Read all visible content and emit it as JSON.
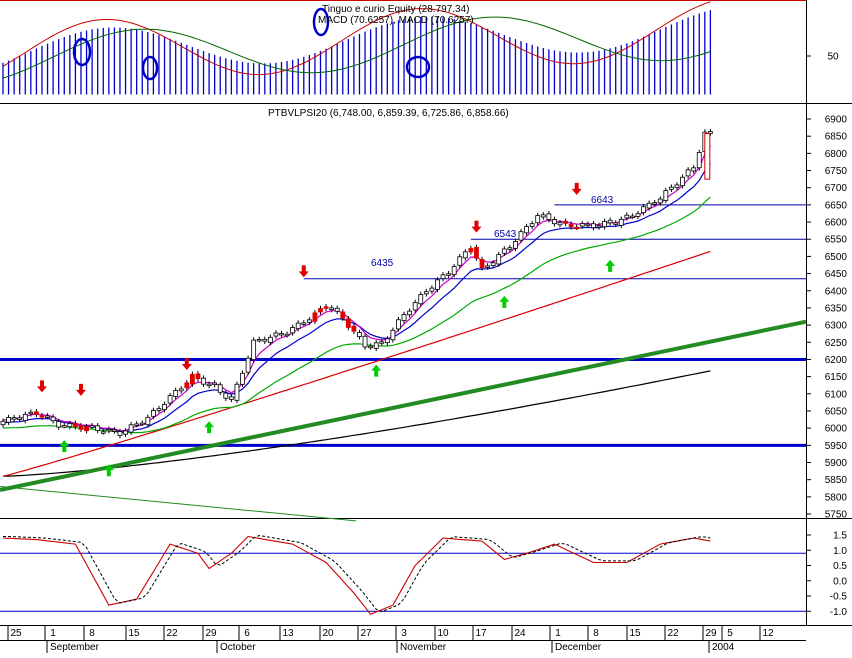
{
  "chart_data": {
    "type": "candlestick",
    "colors": {
      "background": "#ffffff",
      "grid": "#000000",
      "up_candle": "#ffffff",
      "down_candle": "#e00000",
      "ema_short": "#cc00cc",
      "ema_mid": "#0000cc",
      "ema_long": "#00aa00",
      "ema_200": "#dd0000",
      "long_ma": "#000000",
      "trendline": "#228b22",
      "support_lines": "#0000cc",
      "level_lines": "#0000aa",
      "macd_hist": "#0000cc",
      "macd_line": "#cc0000",
      "signal_line": "#006600",
      "stoch_k": "#cc0000",
      "stoch_d": "#000000",
      "sell_arrow": "#e00000",
      "buy_arrow": "#00cc00",
      "circle": "#0000cc"
    },
    "top_panel": {
      "labels": [
        "Tinguo e curio Equity (28.797.34)",
        "MACD (70.6257), MACD (70.6257)"
      ],
      "ticks": [
        "50"
      ],
      "ylim": [
        -20,
        170
      ]
    },
    "main_panel": {
      "title": "PTBVLPSI20 (6,748.00, 6,859.39, 6,725.86, 6,858.66)",
      "ylim": [
        5710,
        6930
      ],
      "ticks": [
        "6900",
        "6850",
        "6800",
        "6750",
        "6700",
        "6650",
        "6600",
        "6550",
        "6500",
        "6450",
        "6400",
        "6350",
        "6300",
        "6250",
        "6200",
        "6150",
        "6100",
        "6050",
        "6000",
        "5950",
        "5900",
        "5850",
        "5800",
        "5750"
      ],
      "level_labels": [
        {
          "text": "6435",
          "value": 6435
        },
        {
          "text": "6543",
          "value": 6550
        },
        {
          "text": "6643",
          "value": 6650
        }
      ],
      "support_lines": [
        6200,
        5950
      ]
    },
    "stoch_panel": {
      "ylim": [
        -1.2,
        1.7
      ],
      "ticks": [
        "1.5",
        "1.0",
        "0.5",
        "0.0",
        "-0.5",
        "-1.0"
      ],
      "reference_lines": [
        0.9,
        -1.0
      ]
    },
    "x_axis": {
      "days": [
        "25",
        "1",
        "8",
        "15",
        "22",
        "29",
        "6",
        "13",
        "20",
        "27",
        "3",
        "10",
        "17",
        "24",
        "1",
        "8",
        "15",
        "22",
        "29",
        "5",
        "12"
      ],
      "months": [
        "September",
        "October",
        "November",
        "December",
        "2004"
      ]
    },
    "annotations": {
      "sell_arrows": 8,
      "buy_arrows": 8,
      "circles": 4
    }
  }
}
